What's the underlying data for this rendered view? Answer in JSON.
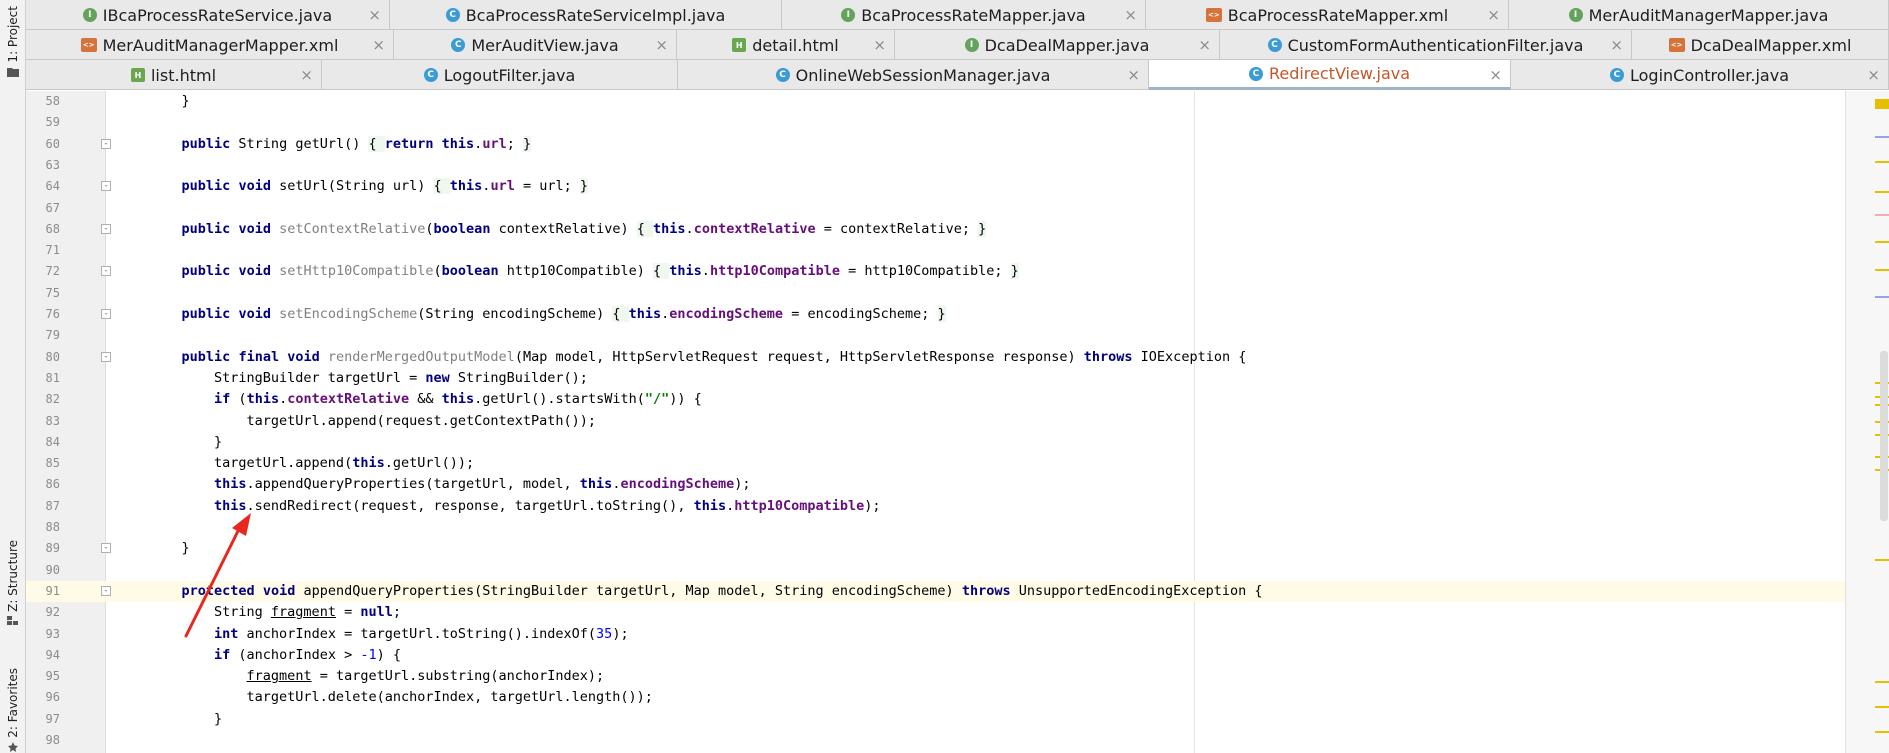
{
  "tool_windows": {
    "project": "1: Project",
    "structure": "Z: Structure",
    "favorites": "2: Favorites"
  },
  "tabs": {
    "row1": [
      {
        "label": "IBcaProcessRateService.java",
        "icon": "interface-icon"
      },
      {
        "label": "BcaProcessRateServiceImpl.java",
        "icon": "class-icon"
      },
      {
        "label": "BcaProcessRateMapper.java",
        "icon": "interface-icon"
      },
      {
        "label": "BcaProcessRateMapper.xml",
        "icon": "xml-icon"
      },
      {
        "label": "MerAuditManagerMapper.java",
        "icon": "interface-icon"
      }
    ],
    "row2": [
      {
        "label": "MerAuditManagerMapper.xml",
        "icon": "xml-icon"
      },
      {
        "label": "MerAuditView.java",
        "icon": "class-icon"
      },
      {
        "label": "detail.html",
        "icon": "html-icon"
      },
      {
        "label": "DcaDealMapper.java",
        "icon": "interface-icon"
      },
      {
        "label": "CustomFormAuthenticationFilter.java",
        "icon": "class-icon"
      },
      {
        "label": "DcaDealMapper.xml",
        "icon": "xml-icon"
      }
    ],
    "row3": [
      {
        "label": "list.html",
        "icon": "html-icon"
      },
      {
        "label": "LogoutFilter.java",
        "icon": "class-icon"
      },
      {
        "label": "OnlineWebSessionManager.java",
        "icon": "class-icon"
      },
      {
        "label": "RedirectView.java",
        "icon": "class-icon",
        "active": true
      },
      {
        "label": "LoginController.java",
        "icon": "class-icon"
      }
    ]
  },
  "code_lines": [
    {
      "n": "58",
      "segments": [
        {
          "t": "    }"
        }
      ]
    },
    {
      "n": "59",
      "segments": []
    },
    {
      "n": "60",
      "fold": true,
      "segments": [
        {
          "t": "    "
        },
        {
          "t": "public",
          "c": "kw"
        },
        {
          "t": " String getUrl() "
        },
        {
          "t": "{ ",
          "c": "brace"
        },
        {
          "t": "return",
          "c": "kw"
        },
        {
          "t": " "
        },
        {
          "t": "this",
          "c": "kw"
        },
        {
          "t": "."
        },
        {
          "t": "url",
          "c": "fld"
        },
        {
          "t": "; "
        },
        {
          "t": "}",
          "c": "brace"
        }
      ]
    },
    {
      "n": "63",
      "segments": []
    },
    {
      "n": "64",
      "fold": true,
      "segments": [
        {
          "t": "    "
        },
        {
          "t": "public",
          "c": "kw"
        },
        {
          "t": " "
        },
        {
          "t": "void",
          "c": "kw"
        },
        {
          "t": " setUrl(String url) "
        },
        {
          "t": "{ ",
          "c": "brace"
        },
        {
          "t": "this",
          "c": "kw"
        },
        {
          "t": "."
        },
        {
          "t": "url",
          "c": "fld"
        },
        {
          "t": " = url; "
        },
        {
          "t": "}",
          "c": "brace"
        }
      ]
    },
    {
      "n": "67",
      "segments": []
    },
    {
      "n": "68",
      "fold": true,
      "segments": [
        {
          "t": "    "
        },
        {
          "t": "public",
          "c": "kw"
        },
        {
          "t": " "
        },
        {
          "t": "void",
          "c": "kw"
        },
        {
          "t": " "
        },
        {
          "t": "setContextRelative",
          "c": "unused"
        },
        {
          "t": "("
        },
        {
          "t": "boolean",
          "c": "kw"
        },
        {
          "t": " contextRelative) "
        },
        {
          "t": "{ ",
          "c": "brace"
        },
        {
          "t": "this",
          "c": "kw"
        },
        {
          "t": "."
        },
        {
          "t": "contextRelative",
          "c": "fld"
        },
        {
          "t": " = contextRelative; "
        },
        {
          "t": "}",
          "c": "brace"
        }
      ]
    },
    {
      "n": "71",
      "segments": []
    },
    {
      "n": "72",
      "fold": true,
      "segments": [
        {
          "t": "    "
        },
        {
          "t": "public",
          "c": "kw"
        },
        {
          "t": " "
        },
        {
          "t": "void",
          "c": "kw"
        },
        {
          "t": " "
        },
        {
          "t": "setHttp10Compatible",
          "c": "unused"
        },
        {
          "t": "("
        },
        {
          "t": "boolean",
          "c": "kw"
        },
        {
          "t": " http10Compatible) "
        },
        {
          "t": "{ ",
          "c": "brace"
        },
        {
          "t": "this",
          "c": "kw"
        },
        {
          "t": "."
        },
        {
          "t": "http10Compatible",
          "c": "fld"
        },
        {
          "t": " = http10Compatible; "
        },
        {
          "t": "}",
          "c": "brace"
        }
      ]
    },
    {
      "n": "75",
      "segments": []
    },
    {
      "n": "76",
      "fold": true,
      "segments": [
        {
          "t": "    "
        },
        {
          "t": "public",
          "c": "kw"
        },
        {
          "t": " "
        },
        {
          "t": "void",
          "c": "kw"
        },
        {
          "t": " "
        },
        {
          "t": "setEncodingScheme",
          "c": "unused"
        },
        {
          "t": "(String encodingScheme) "
        },
        {
          "t": "{ ",
          "c": "brace"
        },
        {
          "t": "this",
          "c": "kw"
        },
        {
          "t": "."
        },
        {
          "t": "encodingScheme",
          "c": "fld"
        },
        {
          "t": " = encodingScheme; "
        },
        {
          "t": "}",
          "c": "brace"
        }
      ]
    },
    {
      "n": "79",
      "segments": []
    },
    {
      "n": "80",
      "fold": true,
      "segments": [
        {
          "t": "    "
        },
        {
          "t": "public",
          "c": "kw"
        },
        {
          "t": " "
        },
        {
          "t": "final",
          "c": "kw"
        },
        {
          "t": " "
        },
        {
          "t": "void",
          "c": "kw"
        },
        {
          "t": " "
        },
        {
          "t": "renderMergedOutputModel",
          "c": "unused"
        },
        {
          "t": "(Map model, HttpServletRequest request, HttpServletResponse response) "
        },
        {
          "t": "throws",
          "c": "kw"
        },
        {
          "t": " IOException {"
        }
      ]
    },
    {
      "n": "81",
      "segments": [
        {
          "t": "        StringBuilder targetUrl = "
        },
        {
          "t": "new",
          "c": "kw"
        },
        {
          "t": " StringBuilder();"
        }
      ]
    },
    {
      "n": "82",
      "segments": [
        {
          "t": "        "
        },
        {
          "t": "if",
          "c": "kw"
        },
        {
          "t": " ("
        },
        {
          "t": "this",
          "c": "kw"
        },
        {
          "t": "."
        },
        {
          "t": "contextRelative",
          "c": "fld"
        },
        {
          "t": " && "
        },
        {
          "t": "this",
          "c": "kw"
        },
        {
          "t": ".getUrl().startsWith("
        },
        {
          "t": "\"/\"",
          "c": "str"
        },
        {
          "t": ")) {"
        }
      ]
    },
    {
      "n": "83",
      "segments": [
        {
          "t": "            targetUrl.append(request.getContextPath());"
        }
      ]
    },
    {
      "n": "84",
      "segments": [
        {
          "t": "        }"
        }
      ]
    },
    {
      "n": "85",
      "segments": [
        {
          "t": "        targetUrl.append("
        },
        {
          "t": "this",
          "c": "kw"
        },
        {
          "t": ".getUrl());"
        }
      ]
    },
    {
      "n": "86",
      "segments": [
        {
          "t": "        "
        },
        {
          "t": "this",
          "c": "kw"
        },
        {
          "t": ".appendQueryProperties(targetUrl, model, "
        },
        {
          "t": "this",
          "c": "kw"
        },
        {
          "t": "."
        },
        {
          "t": "encodingScheme",
          "c": "fld"
        },
        {
          "t": ");"
        }
      ]
    },
    {
      "n": "87",
      "segments": [
        {
          "t": "        "
        },
        {
          "t": "this",
          "c": "kw"
        },
        {
          "t": ".sendRedirect(request, response, targetUrl.toString(), "
        },
        {
          "t": "this",
          "c": "kw"
        },
        {
          "t": "."
        },
        {
          "t": "http10Compatible",
          "c": "fld"
        },
        {
          "t": ");"
        }
      ]
    },
    {
      "n": "88",
      "segments": []
    },
    {
      "n": "89",
      "fold": true,
      "segments": [
        {
          "t": "    }"
        }
      ]
    },
    {
      "n": "90",
      "segments": []
    },
    {
      "n": "91",
      "fold": true,
      "highlight": true,
      "segments": [
        {
          "t": "    "
        },
        {
          "t": "protected",
          "c": "kw"
        },
        {
          "t": " "
        },
        {
          "t": "void",
          "c": "kw"
        },
        {
          "t": " appendQueryProperties(StringBuilder targetUrl, Map model, String encodingScheme) "
        },
        {
          "t": "throws",
          "c": "kw"
        },
        {
          "t": " UnsupportedEncodingException {"
        }
      ]
    },
    {
      "n": "92",
      "segments": [
        {
          "t": "        String "
        },
        {
          "t": "fragment",
          "c": "under"
        },
        {
          "t": " = "
        },
        {
          "t": "null",
          "c": "kw"
        },
        {
          "t": ";"
        }
      ]
    },
    {
      "n": "93",
      "segments": [
        {
          "t": "        "
        },
        {
          "t": "int",
          "c": "kw"
        },
        {
          "t": " anchorIndex = targetUrl.toString().indexOf("
        },
        {
          "t": "35",
          "c": "num"
        },
        {
          "t": ");"
        }
      ]
    },
    {
      "n": "94",
      "segments": [
        {
          "t": "        "
        },
        {
          "t": "if",
          "c": "kw"
        },
        {
          "t": " (anchorIndex > "
        },
        {
          "t": "-1",
          "c": "num"
        },
        {
          "t": ") {"
        }
      ]
    },
    {
      "n": "95",
      "segments": [
        {
          "t": "            "
        },
        {
          "t": "fragment",
          "c": "under"
        },
        {
          "t": " = targetUrl.substring(anchorIndex);"
        }
      ]
    },
    {
      "n": "96",
      "segments": [
        {
          "t": "            targetUrl.delete(anchorIndex, targetUrl.length());"
        }
      ]
    },
    {
      "n": "97",
      "segments": [
        {
          "t": "        }"
        }
      ]
    },
    {
      "n": "98",
      "segments": []
    }
  ],
  "annotation": {
    "color": "#e8281f"
  },
  "colors": {
    "keyword": "#000080",
    "field": "#660e7a",
    "active_tab_text": "#c4572a",
    "marker_yellow": "#e6c000"
  }
}
